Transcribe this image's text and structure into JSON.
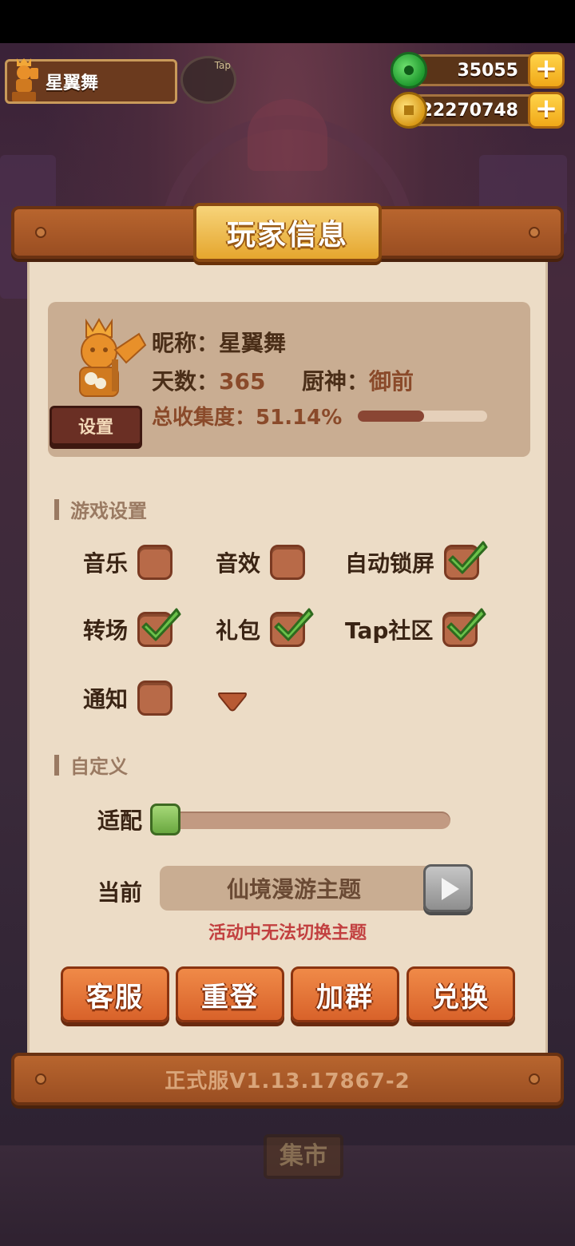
{
  "hud": {
    "player_name": "星翼舞",
    "tap_label": "Tap",
    "jade": "35055",
    "coins": "22270748",
    "plus": "+"
  },
  "panel": {
    "title": "玩家信息",
    "settings_button": "设置",
    "nickname_label": "昵称：",
    "nickname": "星翼舞",
    "days_label": "天数：",
    "days": "365",
    "chef_label": "厨神：",
    "chef": "御前",
    "collection_label": "总收集度：",
    "collection": "51.14%",
    "collection_fraction": 0.5114
  },
  "game_settings": {
    "heading": "游戏设置",
    "options": [
      {
        "label": "音乐",
        "checked": false
      },
      {
        "label": "音效",
        "checked": false
      },
      {
        "label": "自动锁屏",
        "checked": true
      },
      {
        "label": "转场",
        "checked": true
      },
      {
        "label": "礼包",
        "checked": true
      },
      {
        "label": "Tap社区",
        "checked": true
      },
      {
        "label": "通知",
        "checked": false
      }
    ]
  },
  "custom": {
    "heading": "自定义",
    "adapt_label": "适配",
    "adapt_level": 0,
    "current_label": "当前",
    "current_theme": "仙境漫游主题",
    "warning": "活动中无法切换主题"
  },
  "actions": [
    "客服",
    "重登",
    "加群",
    "兑换"
  ],
  "footer": {
    "version": "正式服V1.13.17867-2"
  },
  "background": {
    "market_sign": "集市"
  },
  "colors": {
    "wood": "#b8652e",
    "paper": "#ecdcc6",
    "checkbox": "#b86a48",
    "check_green": "#6ac24a",
    "action_orange": "#e8743a",
    "warning_red": "#c24040"
  }
}
